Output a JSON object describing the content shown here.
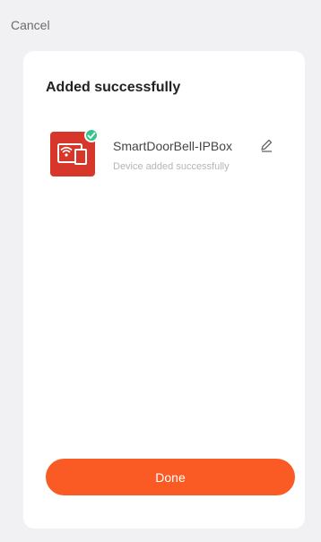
{
  "header": {
    "cancel_label": "Cancel"
  },
  "card": {
    "title": "Added successfully",
    "device": {
      "name": "SmartDoorBell-IPBox",
      "status": "Device added successfully",
      "icon": "doorbell-device-icon",
      "badge_icon": "check-icon",
      "edit_icon": "pencil-icon"
    },
    "done_label": "Done"
  },
  "colors": {
    "accent": "#fa5b24",
    "device_tile": "#d6372a",
    "success_badge": "#35c48b"
  }
}
